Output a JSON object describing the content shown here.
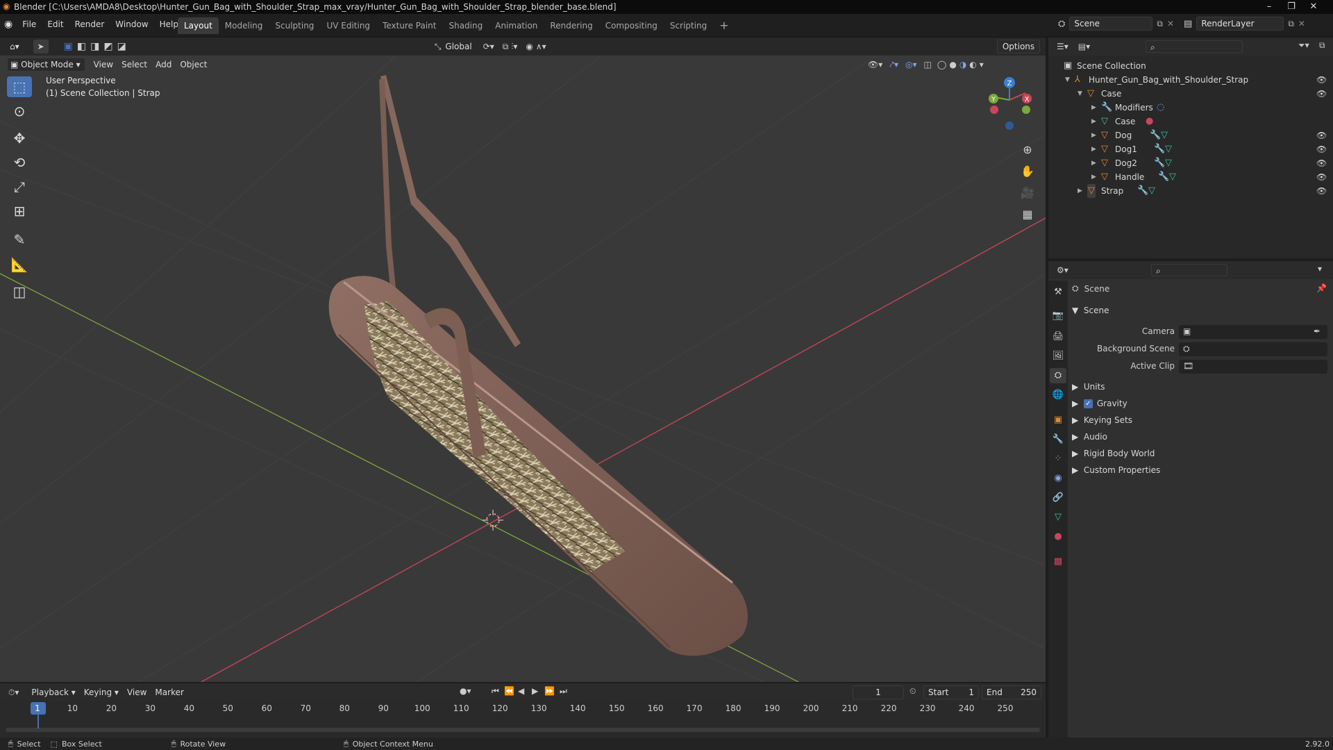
{
  "titlebar": {
    "title": "Blender [C:\\Users\\AMDA8\\Desktop\\Hunter_Gun_Bag_with_Shoulder_Strap_max_vray/Hunter_Gun_Bag_with_Shoulder_Strap_blender_base.blend]"
  },
  "menu": [
    "File",
    "Edit",
    "Render",
    "Window",
    "Help"
  ],
  "workspaces": [
    "Layout",
    "Modeling",
    "Sculpting",
    "UV Editing",
    "Texture Paint",
    "Shading",
    "Animation",
    "Rendering",
    "Compositing",
    "Scripting"
  ],
  "active_workspace": "Layout",
  "scene_name": "Scene",
  "render_layer": "RenderLayer",
  "toolbar": {
    "orientation": "Global",
    "options_label": "Options"
  },
  "viewport": {
    "mode": "Object Mode",
    "menus": [
      "View",
      "Select",
      "Add",
      "Object"
    ],
    "info_line1": "User Perspective",
    "info_line2": "(1) Scene Collection | Strap",
    "gizmo_x": "X",
    "gizmo_y": "Y",
    "gizmo_z": "Z"
  },
  "outliner": {
    "root": "Scene Collection",
    "items": [
      {
        "label": "Hunter_Gun_Bag_with_Shoulder_Strap"
      },
      {
        "label": "Case"
      },
      {
        "label": "Modifiers"
      },
      {
        "label": "Case"
      },
      {
        "label": "Dog"
      },
      {
        "label": "Dog1"
      },
      {
        "label": "Dog2"
      },
      {
        "label": "Handle"
      },
      {
        "label": "Strap"
      }
    ]
  },
  "properties": {
    "context": "Scene",
    "panel": "Scene",
    "camera_label": "Camera",
    "background_scene_label": "Background Scene",
    "active_clip_label": "Active Clip",
    "subpanels": [
      "Units",
      "Gravity",
      "Keying Sets",
      "Audio",
      "Rigid Body World",
      "Custom Properties"
    ]
  },
  "timeline": {
    "menus": [
      "Playback",
      "Keying",
      "View",
      "Marker"
    ],
    "current_frame": "1",
    "start_label": "Start",
    "start": "1",
    "end_label": "End",
    "end": "250",
    "ticks": [
      "1",
      "10",
      "20",
      "30",
      "40",
      "50",
      "60",
      "70",
      "80",
      "90",
      "100",
      "110",
      "120",
      "130",
      "140",
      "150",
      "160",
      "170",
      "180",
      "190",
      "200",
      "210",
      "220",
      "230",
      "240",
      "250"
    ]
  },
  "statusbar": {
    "select": "Select",
    "box_select": "Box Select",
    "rotate_view": "Rotate View",
    "context_menu": "Object Context Menu",
    "version": "2.92.0"
  },
  "colors": {
    "accent": "#4772b3",
    "axis_x": "#c9475a",
    "axis_y": "#7ea83a",
    "axis_z": "#3b7fd4",
    "object_orange": "#e08a30"
  }
}
